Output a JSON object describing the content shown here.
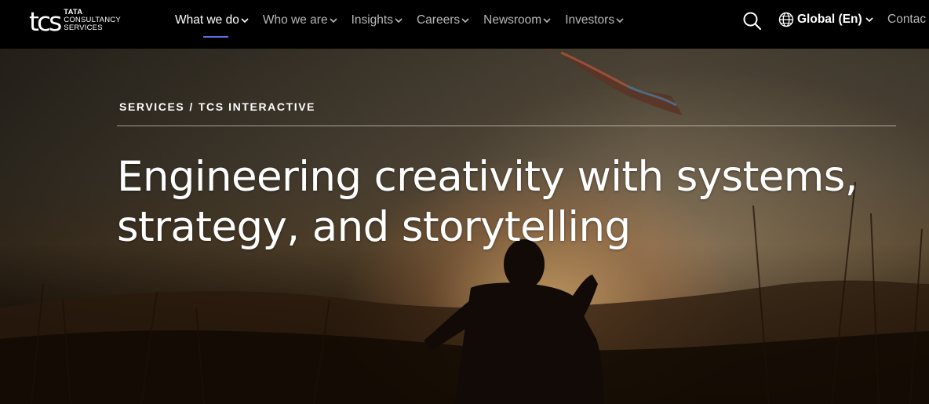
{
  "header": {
    "logo": {
      "mark": "tcs",
      "line1": "TATA",
      "line2": "CONSULTANCY",
      "line3": "SERVICES"
    },
    "nav": [
      {
        "label": "What we do",
        "active": true
      },
      {
        "label": "Who we are",
        "active": false
      },
      {
        "label": "Insights",
        "active": false
      },
      {
        "label": "Careers",
        "active": false
      },
      {
        "label": "Newsroom",
        "active": false
      },
      {
        "label": "Investors",
        "active": false
      }
    ],
    "search_icon": "search-icon",
    "language": "Global (En)",
    "contact": "Contac"
  },
  "hero": {
    "breadcrumb": {
      "part1": "SERVICES",
      "separator": "/",
      "part2": "TCS INTERACTIVE"
    },
    "headline": "Engineering creativity with systems, strategy, and storytelling"
  },
  "colors": {
    "nav_background": "#000000",
    "active_underline": "#5c6fe0",
    "text": "#ffffff",
    "muted_text": "#b8b8b8"
  }
}
